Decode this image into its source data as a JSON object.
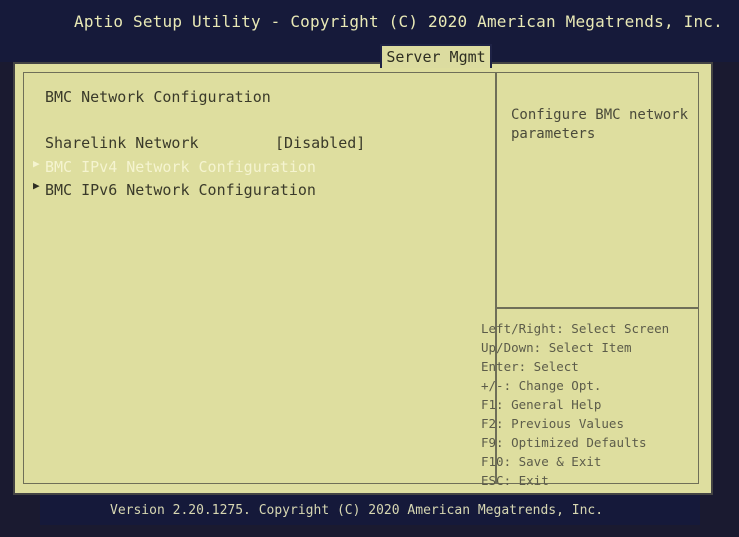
{
  "header": {
    "title": "Aptio Setup Utility - Copyright (C) 2020 American Megatrends, Inc.",
    "active_tab": "Server Mgmt"
  },
  "main": {
    "section_title": "BMC Network Configuration",
    "items": [
      {
        "label": "Sharelink Network",
        "value": "[Disabled]"
      },
      {
        "label": "BMC IPv4 Network Configuration"
      },
      {
        "label": "BMC IPv6 Network Configuration"
      }
    ]
  },
  "help": {
    "text": "Configure BMC network parameters"
  },
  "keys": [
    "Left/Right: Select Screen",
    "Up/Down: Select Item",
    "Enter: Select",
    "+/-: Change Opt.",
    "F1: General Help",
    "F2: Previous Values",
    "F9: Optimized Defaults",
    "F10: Save & Exit",
    "ESC: Exit"
  ],
  "footer": {
    "text": "Version 2.20.1275. Copyright (C) 2020 American Megatrends, Inc."
  },
  "colors": {
    "panel_background": "#dede9f",
    "highlight_text": "#f5f4d0",
    "header_background": "#161a3a"
  }
}
